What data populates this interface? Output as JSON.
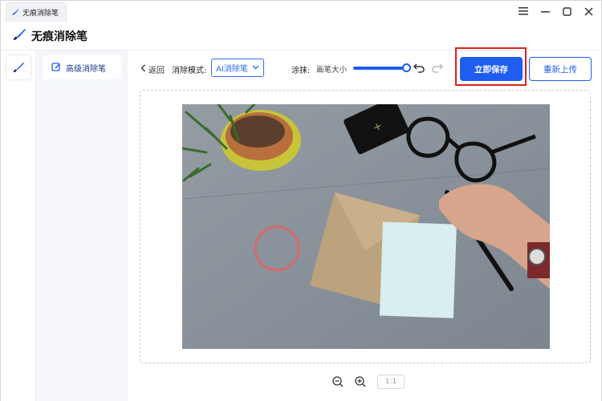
{
  "window": {
    "tab_title": "无痕消除笔",
    "controls": [
      "minimize",
      "maximize",
      "close"
    ]
  },
  "app": {
    "title": "无痕消除笔"
  },
  "sidebar": {
    "items": [
      {
        "label": "高级消除笔",
        "icon": "edit-icon",
        "active": true
      }
    ]
  },
  "toolbar": {
    "back_label": "返回",
    "mode_label": "消除模式:",
    "mode_value": "AI消除笔",
    "smear_label": "涂抹:",
    "brush_size_label": "画笔大小",
    "brush_size_level": 1.0,
    "save_label": "立即保存",
    "reupload_label": "重新上传"
  },
  "zoom": {
    "ratio_label": "1:1"
  },
  "colors": {
    "accent": "#1f5cf0",
    "highlight": "#e02020",
    "sidebar_bg": "#f4f6fa"
  }
}
